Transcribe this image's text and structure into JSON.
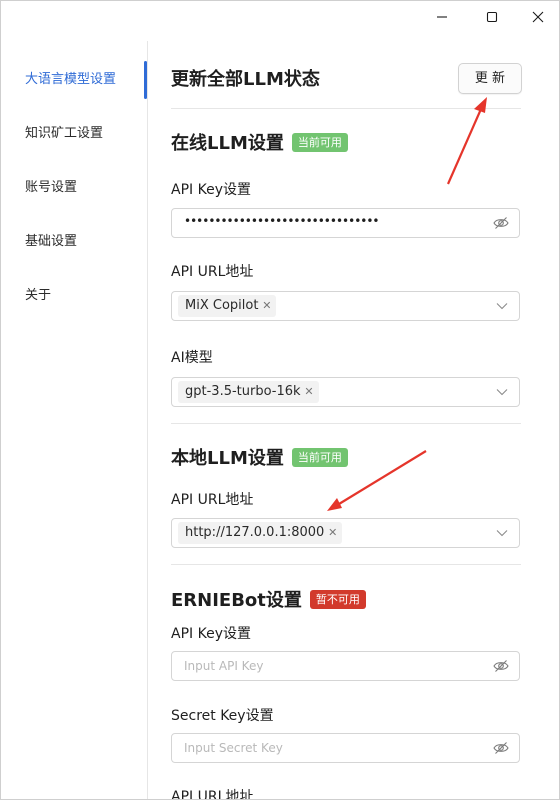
{
  "window": {
    "controls": {
      "minimize": "minimize",
      "maximize": "maximize",
      "close": "close"
    }
  },
  "sidebar": {
    "items": [
      {
        "label": "大语言模型设置",
        "active": true
      },
      {
        "label": "知识矿工设置",
        "active": false
      },
      {
        "label": "账号设置",
        "active": false
      },
      {
        "label": "基础设置",
        "active": false
      },
      {
        "label": "关于",
        "active": false
      }
    ]
  },
  "header": {
    "title": "更新全部LLM状态",
    "update_button": "更 新"
  },
  "online": {
    "title": "在线LLM设置",
    "badge": "当前可用",
    "api_key_label": "API Key设置",
    "api_key_value": "••••••••••••••••••••••••••••••••",
    "api_url_label": "API URL地址",
    "api_url_tag": "MiX Copilot",
    "model_label": "AI模型",
    "model_tag": "gpt-3.5-turbo-16k"
  },
  "local": {
    "title": "本地LLM设置",
    "badge": "当前可用",
    "api_url_label": "API URL地址",
    "api_url_tag": "http://127.0.0.1:8000"
  },
  "ernie": {
    "title": "ERNIEBot设置",
    "badge": "暂不可用",
    "api_key_label": "API Key设置",
    "api_key_placeholder": "Input API Key",
    "secret_key_label": "Secret Key设置",
    "secret_key_placeholder": "Input Secret Key",
    "api_url_label": "API URL地址"
  },
  "colors": {
    "accent": "#2f6bd6",
    "badge_available": "#72c470",
    "badge_unavailable": "#d23a2c",
    "annotation_arrow": "#e5352b"
  }
}
